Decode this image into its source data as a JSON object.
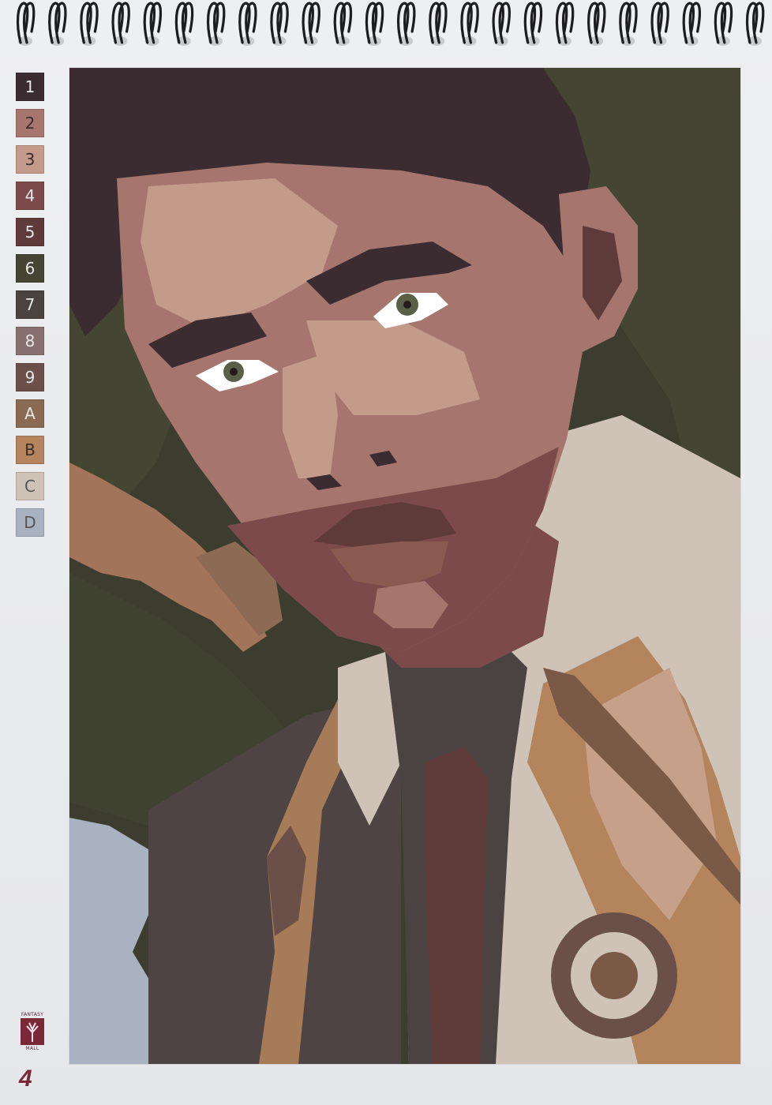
{
  "palette": [
    {
      "label": "1",
      "color": "#3a2c30",
      "text_color": "#e6e6e6"
    },
    {
      "label": "2",
      "color": "#a6766e",
      "text_color": "#3a2c2c"
    },
    {
      "label": "3",
      "color": "#c49a8a",
      "text_color": "#3a2c2c"
    },
    {
      "label": "4",
      "color": "#7c4a4a",
      "text_color": "#e6e6e6"
    },
    {
      "label": "5",
      "color": "#5e3a38",
      "text_color": "#e6e6e6"
    },
    {
      "label": "6",
      "color": "#444532",
      "text_color": "#e6e6e6"
    },
    {
      "label": "7",
      "color": "#4b4242",
      "text_color": "#e6e6e6"
    },
    {
      "label": "8",
      "color": "#887070",
      "text_color": "#e6e6e6"
    },
    {
      "label": "9",
      "color": "#6a5048",
      "text_color": "#e6e6e6"
    },
    {
      "label": "A",
      "color": "#8a6a50",
      "text_color": "#e6e6e6"
    },
    {
      "label": "B",
      "color": "#b4845c",
      "text_color": "#3a2c2c"
    },
    {
      "label": "C",
      "color": "#cfc3b8",
      "text_color": "#555555"
    },
    {
      "label": "D",
      "color": "#a8b2c0",
      "text_color": "#555555"
    }
  ],
  "brand": {
    "line1": "FANTASY",
    "line2": "MALL",
    "logo_icon": "tree-logo-icon",
    "color": "#7a2838"
  },
  "page_number": "4",
  "artwork": {
    "subject": "paint-by-number portrait",
    "icons": [
      "spiral-binding-icon"
    ]
  }
}
